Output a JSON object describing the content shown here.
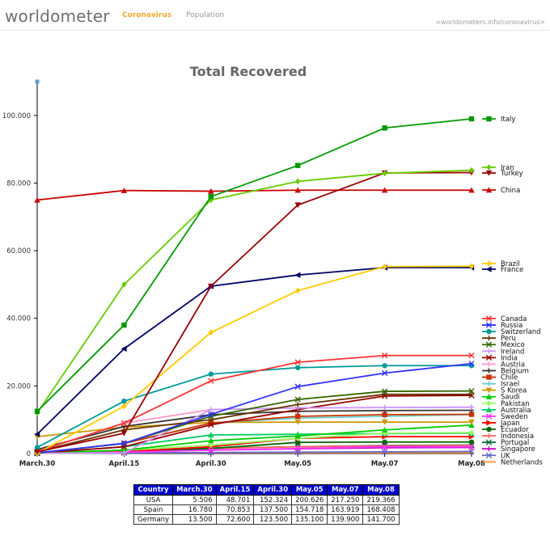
{
  "header": {
    "logo_prefix": "worldometer",
    "nav": [
      "Coronavirus",
      "Population"
    ],
    "site_url": "<worldometers.info/coronavirus>"
  },
  "chart_data": {
    "type": "line",
    "title": "Total Recovered",
    "categories": [
      "March.30",
      "April.15",
      "April.30",
      "May.05",
      "May.07",
      "May.08"
    ],
    "ylim": [
      0,
      110000
    ],
    "yticks": [
      0,
      20000,
      40000,
      60000,
      80000,
      100000
    ],
    "ytick_labels": [
      "0",
      "20.000",
      "40.000",
      "60.000",
      "80.000",
      "100.000"
    ],
    "grid": false,
    "legend": "right",
    "series": [
      {
        "name": "Italy",
        "color": "#009900",
        "marker": "square",
        "values": [
          12500,
          38000,
          76000,
          85200,
          96300,
          99000
        ]
      },
      {
        "name": "Iran",
        "color": "#66cc00",
        "marker": "diamond",
        "values": [
          12000,
          50000,
          75000,
          80500,
          82900,
          83800
        ]
      },
      {
        "name": "Turkey",
        "color": "#990000",
        "marker": "tri-down",
        "values": [
          500,
          6000,
          49500,
          73500,
          83000,
          83100
        ]
      },
      {
        "name": "China",
        "color": "#cc0000",
        "marker": "tri-up",
        "values": [
          75000,
          77800,
          77600,
          77900,
          77900,
          77900
        ]
      },
      {
        "name": "Brazil",
        "color": "#ffcc00",
        "marker": "diamond",
        "values": [
          100,
          14000,
          35800,
          48200,
          55300,
          55400
        ]
      },
      {
        "name": "France",
        "color": "#000066",
        "marker": "tri-left",
        "values": [
          5700,
          31000,
          49500,
          52800,
          55000,
          55000
        ]
      },
      {
        "name": "Canada",
        "color": "#ff3333",
        "marker": "x",
        "values": [
          600,
          9000,
          21500,
          27000,
          29000,
          29000
        ]
      },
      {
        "name": "Russia",
        "color": "#3333ff",
        "marker": "x",
        "values": [
          200,
          3000,
          11600,
          19800,
          23800,
          26600
        ]
      },
      {
        "name": "Switzerland",
        "color": "#009999",
        "marker": "circle",
        "values": [
          1800,
          15500,
          23500,
          25400,
          26000,
          26000
        ]
      },
      {
        "name": "Peru",
        "color": "#663300",
        "marker": "plus",
        "values": [
          500,
          7000,
          10000,
          14500,
          17500,
          17500
        ]
      },
      {
        "name": "Mexico",
        "color": "#336600",
        "marker": "x",
        "values": [
          100,
          3000,
          11000,
          16000,
          18400,
          18500
        ]
      },
      {
        "name": "Ireland",
        "color": "#cc99ff",
        "marker": "plus",
        "values": [
          100,
          200,
          13000,
          13500,
          13600,
          13700
        ]
      },
      {
        "name": "India",
        "color": "#990000",
        "marker": "x",
        "values": [
          100,
          2000,
          8500,
          13000,
          17000,
          17200
        ]
      },
      {
        "name": "Austria",
        "color": "#ff99cc",
        "marker": "plus",
        "values": [
          600,
          9000,
          13000,
          13500,
          13600,
          13700
        ]
      },
      {
        "name": "Belgium",
        "color": "#333333",
        "marker": "plus",
        "values": [
          1200,
          8000,
          11500,
          12500,
          12700,
          12800
        ]
      },
      {
        "name": "Chile",
        "color": "#cc3300",
        "marker": "square",
        "values": [
          200,
          3000,
          9000,
          11000,
          11500,
          11600
        ]
      },
      {
        "name": "Israel",
        "color": "#66cccc",
        "marker": "plus",
        "values": [
          200,
          3000,
          9000,
          10500,
          11000,
          11500
        ]
      },
      {
        "name": "S Korea",
        "color": "#cc9900",
        "marker": "tri-down",
        "values": [
          5000,
          7800,
          9200,
          9300,
          9300,
          9300
        ]
      },
      {
        "name": "Saudi",
        "color": "#00cc00",
        "marker": "tri-up",
        "values": [
          100,
          1000,
          3800,
          5200,
          7000,
          8400
        ]
      },
      {
        "name": "Pakistan",
        "color": "#99ff66",
        "marker": "diamond",
        "values": [
          100,
          1000,
          2500,
          4500,
          6000,
          6200
        ]
      },
      {
        "name": "Australia",
        "color": "#00cc66",
        "marker": "tri-up",
        "values": [
          100,
          2000,
          5500,
          5700,
          5900,
          6000
        ]
      },
      {
        "name": "Sweden",
        "color": "#ff33ff",
        "marker": "x",
        "values": [
          100,
          400,
          1000,
          1500,
          2000,
          2000
        ]
      },
      {
        "name": "Japan",
        "color": "#ff0000",
        "marker": "tri-right",
        "values": [
          100,
          600,
          2000,
          4500,
          5000,
          5000
        ]
      },
      {
        "name": "Ecuador",
        "color": "#006600",
        "marker": "circle",
        "values": [
          100,
          500,
          1500,
          3300,
          3400,
          3400
        ]
      },
      {
        "name": "Indonesia",
        "color": "#ff6666",
        "marker": "plus",
        "values": [
          100,
          500,
          1500,
          2000,
          2300,
          2400
        ]
      },
      {
        "name": "Portugal",
        "color": "#006633",
        "marker": "x",
        "values": [
          100,
          300,
          1600,
          2000,
          2400,
          2500
        ]
      },
      {
        "name": "Singapore",
        "color": "#cc00cc",
        "marker": "plus",
        "values": [
          100,
          700,
          1000,
          1400,
          1700,
          1800
        ]
      },
      {
        "name": "UK",
        "color": "#6666cc",
        "marker": "x",
        "values": [
          100,
          200,
          300,
          400,
          500,
          600
        ]
      },
      {
        "name": "Netherlands",
        "color": "#ff9933",
        "marker": "line",
        "values": [
          100,
          200,
          250,
          250,
          250,
          250
        ]
      }
    ]
  },
  "table": {
    "headers": [
      "Country",
      "March.30",
      "April.15",
      "April.30",
      "May.05",
      "May.07",
      "May.08"
    ],
    "rows": [
      [
        "USA",
        "5.506",
        "48.701",
        "152.324",
        "200.626",
        "217.250",
        "219.366"
      ],
      [
        "Spain",
        "16.780",
        "70.853",
        "137.500",
        "154.718",
        "163.919",
        "168.408"
      ],
      [
        "Germany",
        "13.500",
        "72.600",
        "123.500",
        "135.100",
        "139.900",
        "141.700"
      ]
    ]
  }
}
